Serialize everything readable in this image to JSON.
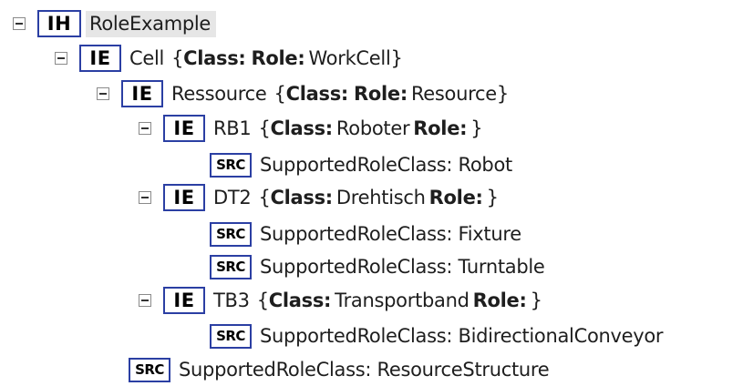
{
  "root": {
    "badge": "IH",
    "label": "RoleExample"
  },
  "cell": {
    "badge": "IE",
    "name": "Cell",
    "open": "{",
    "class_key": "Class:",
    "class_val": "",
    "role_key": "Role:",
    "role_val": "WorkCell",
    "close": "}"
  },
  "ressource": {
    "badge": "IE",
    "name": "Ressource",
    "open": "{",
    "class_key": "Class:",
    "class_val": "",
    "role_key": "Role:",
    "role_val": "Resource",
    "close": "}"
  },
  "rb1": {
    "badge": "IE",
    "name": "RB1",
    "open": "{",
    "class_key": "Class:",
    "class_val": "Roboter",
    "role_key": "Role:",
    "role_val": "",
    "close": "}",
    "src": [
      {
        "badge": "SRC",
        "text": "SupportedRoleClass: Robot"
      }
    ]
  },
  "dt2": {
    "badge": "IE",
    "name": "DT2",
    "open": "{",
    "class_key": "Class:",
    "class_val": "Drehtisch",
    "role_key": "Role:",
    "role_val": "",
    "close": "}",
    "src": [
      {
        "badge": "SRC",
        "text": "SupportedRoleClass: Fixture"
      },
      {
        "badge": "SRC",
        "text": "SupportedRoleClass: Turntable"
      }
    ]
  },
  "tb3": {
    "badge": "IE",
    "name": "TB3",
    "open": "{",
    "class_key": "Class:",
    "class_val": "Transportband",
    "role_key": "Role:",
    "role_val": "",
    "close": "}",
    "src": [
      {
        "badge": "SRC",
        "text": "SupportedRoleClass: BidirectionalConveyor"
      }
    ]
  },
  "resource_src": {
    "badge": "SRC",
    "text": "SupportedRoleClass: ResourceStructure"
  },
  "colors": {
    "badge_border": "#2b3fa3",
    "selection": "#e6e6e6",
    "toggle_border": "#8a8a8a"
  },
  "icons": {
    "collapse": "collapse-minus-icon"
  }
}
